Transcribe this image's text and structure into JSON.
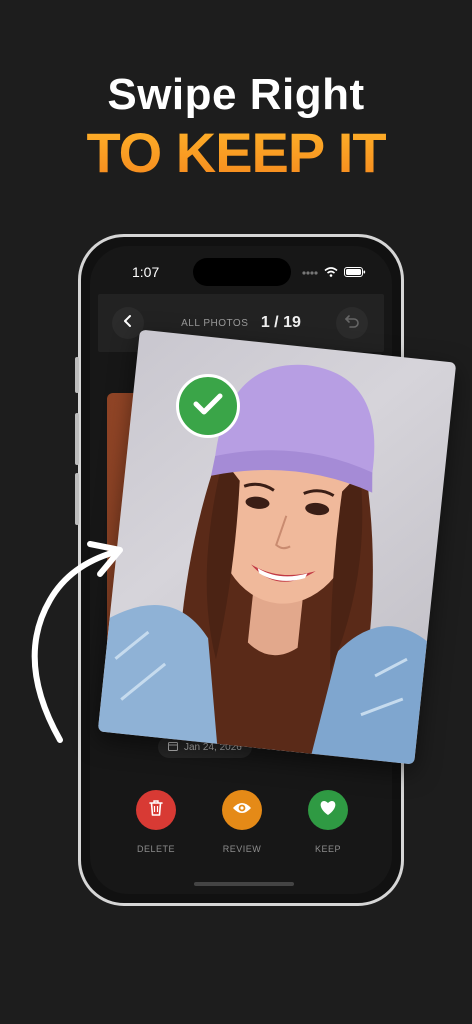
{
  "headline": "Swipe Right",
  "subheadline": "TO KEEP IT",
  "status": {
    "time": "1:07"
  },
  "topbar": {
    "label": "ALL PHOTOS",
    "counter": "1 / 19"
  },
  "photo": {
    "date": "Jan 24, 2026"
  },
  "actions": [
    {
      "label": "DELETE",
      "color": "#d83a34",
      "icon": "trash-icon"
    },
    {
      "label": "REVIEW",
      "color": "#e58a17",
      "icon": "eye-icon"
    },
    {
      "label": "KEEP",
      "color": "#2f9a43",
      "icon": "heart-icon"
    }
  ],
  "colors": {
    "background": "#1d1d1d",
    "accent": "#f59a1b",
    "keep": "#3aa548"
  }
}
